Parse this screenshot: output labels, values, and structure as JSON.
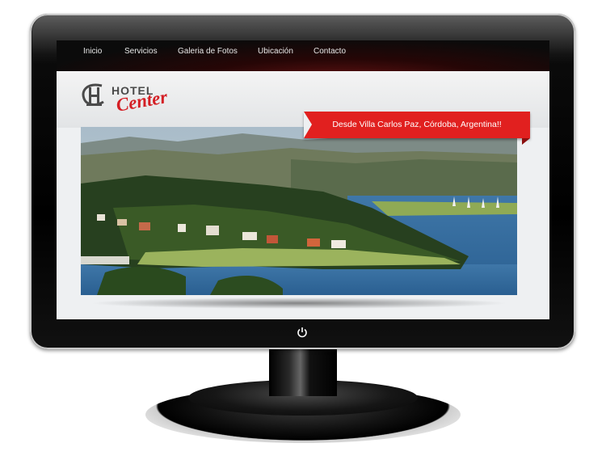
{
  "nav": {
    "items": [
      "Inicio",
      "Servicios",
      "Galeria de Fotos",
      "Ubicación",
      "Contacto"
    ]
  },
  "logo": {
    "hotel": "HOTEL",
    "center": "Center"
  },
  "banner": {
    "text": "Desde Villa Carlos Paz, Córdoba, Argentina!!"
  },
  "colors": {
    "accent": "#e1201f",
    "nav_bg": "#0b0b0b",
    "monitor": "#000000"
  },
  "icons": {
    "power": "power-icon",
    "logo": "hotel-monogram-logo"
  }
}
